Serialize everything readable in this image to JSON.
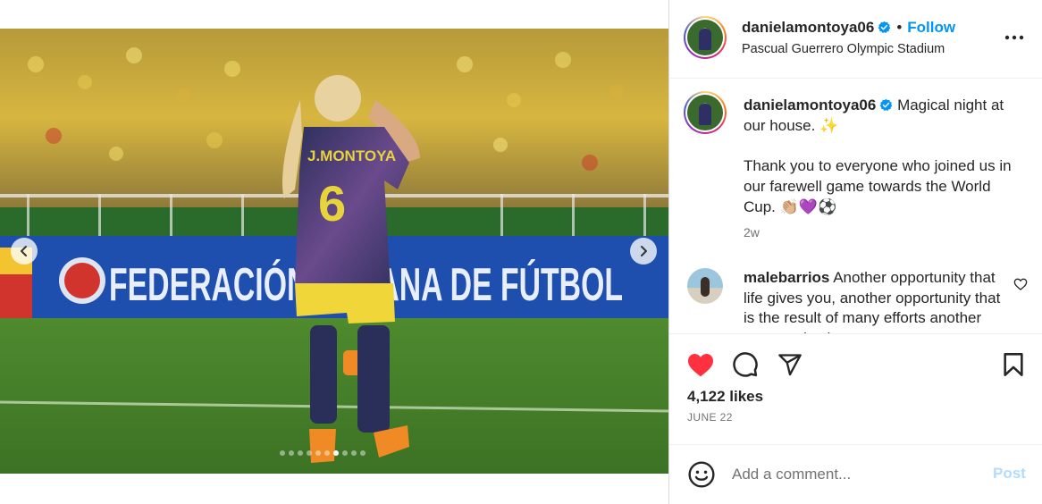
{
  "post": {
    "media": {
      "banner_text": "FEDERACIÓN C    BIANA DE FÚTBOL",
      "jersey_name": "J.MONTOYA",
      "jersey_number": "6",
      "slide_count": 10,
      "active_slide": 7,
      "prev_icon": "chevron-left-icon",
      "next_icon": "chevron-right-icon"
    },
    "header": {
      "username": "danielamontoya06",
      "separator": "•",
      "follow_label": "Follow",
      "location": "Pascual Guerrero Olympic Stadium",
      "more_icon": "more-horizontal-icon"
    },
    "caption": {
      "username": "danielamontoya06",
      "text_line1": "Magical night at our house. ✨",
      "text_line2": "Thank you to everyone who joined us in our farewell game towards the World Cup. 👏🏼💜⚽",
      "time": "2w"
    },
    "comment": {
      "username": "malebarrios",
      "text": "Another opportunity that life gives you, another opportunity that is the result of many efforts another opportunity that"
    },
    "actions": {
      "likes": "4,122 likes",
      "date": "JUNE 22"
    },
    "composer": {
      "placeholder": "Add a comment...",
      "post_label": "Post"
    },
    "colors": {
      "accent": "#0095f6",
      "like": "#ff3040",
      "post_disabled": "#b3dbff",
      "verified": "#0095f6"
    }
  }
}
